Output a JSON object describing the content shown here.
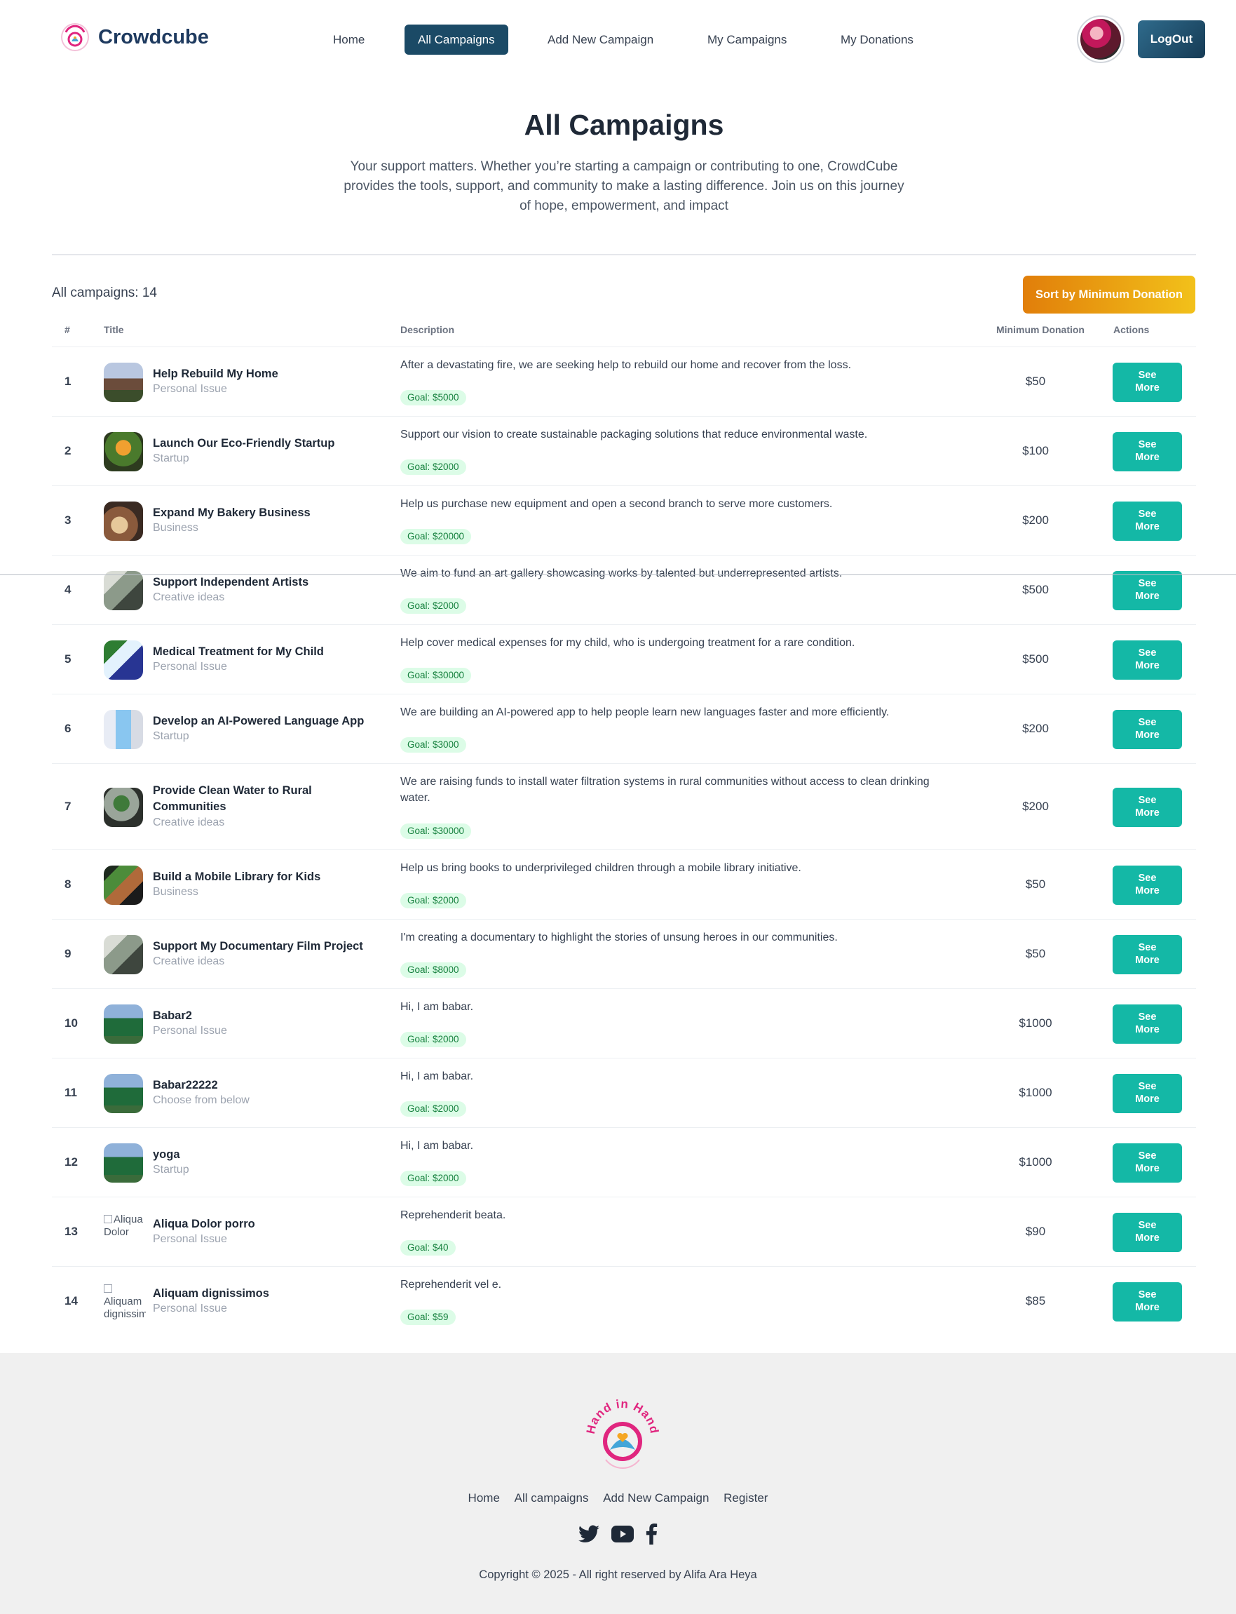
{
  "brand": {
    "name": "Crowdcube",
    "logo_text": "Hand in Hand"
  },
  "nav": {
    "links": [
      "Home",
      "All Campaigns",
      "Add New Campaign",
      "My Campaigns",
      "My Donations"
    ],
    "active": "All Campaigns",
    "logout_label": "LogOut"
  },
  "hero": {
    "title": "All Campaigns",
    "text": "Your support matters. Whether you’re starting a campaign or contributing to one, CrowdCube provides the tools, support, and community to make a lasting difference. Join us on this journey of hope, empowerment, and impact"
  },
  "toolbar": {
    "count_label": "All campaigns: 14",
    "sort_label": "Sort by Minimum Donation"
  },
  "table": {
    "headers": {
      "num": "#",
      "title": "Title",
      "description": "Description",
      "min": "Minimum Donation",
      "actions": "Actions"
    },
    "action_label_1": "See",
    "action_label_2": "More",
    "rows": [
      {
        "num": "1",
        "title": "Help Rebuild My Home",
        "category": "Personal Issue",
        "description": "After a devastating fire, we are seeking help to rebuild our home and recover from the loss.",
        "goal": "Goal: $5000",
        "min": "$50",
        "thumb": "house"
      },
      {
        "num": "2",
        "title": "Launch Our Eco-Friendly Startup",
        "category": "Startup",
        "description": "Support our vision to create sustainable packaging solutions that reduce environmental waste.",
        "goal": "Goal: $2000",
        "min": "$100",
        "thumb": "plants"
      },
      {
        "num": "3",
        "title": "Expand My Bakery Business",
        "category": "Business",
        "description": "Help us purchase new equipment and open a second branch to serve more customers.",
        "goal": "Goal: $20000",
        "min": "$200",
        "thumb": "bakery"
      },
      {
        "num": "4",
        "title": "Support Independent Artists",
        "category": "Creative ideas",
        "description": "We aim to fund an art gallery showcasing works by talented but underrepresented artists.",
        "goal": "Goal: $2000",
        "min": "$500",
        "thumb": "art"
      },
      {
        "num": "5",
        "title": "Medical Treatment for My Child",
        "category": "Personal Issue",
        "description": "Help cover medical expenses for my child, who is undergoing treatment for a rare condition.",
        "goal": "Goal: $30000",
        "min": "$500",
        "thumb": "medical"
      },
      {
        "num": "6",
        "title": "Develop an AI-Powered Language App",
        "category": "Startup",
        "description": "We are building an AI-powered app to help people learn new languages faster and more efficiently.",
        "goal": "Goal: $3000",
        "min": "$200",
        "thumb": "phone"
      },
      {
        "num": "7",
        "title": "Provide Clean Water to Rural Communities",
        "category": "Creative ideas",
        "description": "We are raising funds to install water filtration systems in rural communities without access to clean drinking water.",
        "goal": "Goal: $30000",
        "min": "$200",
        "thumb": "water"
      },
      {
        "num": "8",
        "title": "Build a Mobile Library for Kids",
        "category": "Business",
        "description": "Help us bring books to underprivileged children through a mobile library initiative.",
        "goal": "Goal: $2000",
        "min": "$50",
        "thumb": "library"
      },
      {
        "num": "9",
        "title": "Support My Documentary Film Project",
        "category": "Creative ideas",
        "description": "I'm creating a documentary to highlight the stories of unsung heroes in our communities.",
        "goal": "Goal: $8000",
        "min": "$50",
        "thumb": "art"
      },
      {
        "num": "10",
        "title": "Babar2",
        "category": "Personal Issue",
        "description": "Hi, I am babar.",
        "goal": "Goal: $2000",
        "min": "$1000",
        "thumb": "cricket"
      },
      {
        "num": "11",
        "title": "Babar22222",
        "category": "Choose from below",
        "description": "Hi, I am babar.",
        "goal": "Goal: $2000",
        "min": "$1000",
        "thumb": "cricket"
      },
      {
        "num": "12",
        "title": "yoga",
        "category": "Startup",
        "description": "Hi, I am babar.",
        "goal": "Goal: $2000",
        "min": "$1000",
        "thumb": "cricket"
      },
      {
        "num": "13",
        "title": "Aliqua Dolor porro",
        "category": "Personal Issue",
        "description": "Reprehenderit beata.",
        "goal": "Goal: $40",
        "min": "$90",
        "thumb": "broken",
        "alt": "Aliqua Dolor"
      },
      {
        "num": "14",
        "title": "Aliquam dignissimos",
        "category": "Personal Issue",
        "description": "Reprehenderit vel e.",
        "goal": "Goal: $59",
        "min": "$85",
        "thumb": "broken",
        "alt": "Aliquam dignissimos"
      }
    ]
  },
  "footer": {
    "links": [
      "Home",
      "All campaigns",
      "Add New Campaign",
      "Register"
    ],
    "social": [
      "twitter-icon",
      "youtube-icon",
      "facebook-icon"
    ],
    "copyright": "Copyright © 2025 - All right reserved by Alifa Ara Heya"
  },
  "colors": {
    "brand": "#1e3a5f",
    "accent": "#14b8a6",
    "sort_start": "#e17e0a",
    "sort_end": "#f2c11a",
    "nav_active": "#1b4a66"
  }
}
